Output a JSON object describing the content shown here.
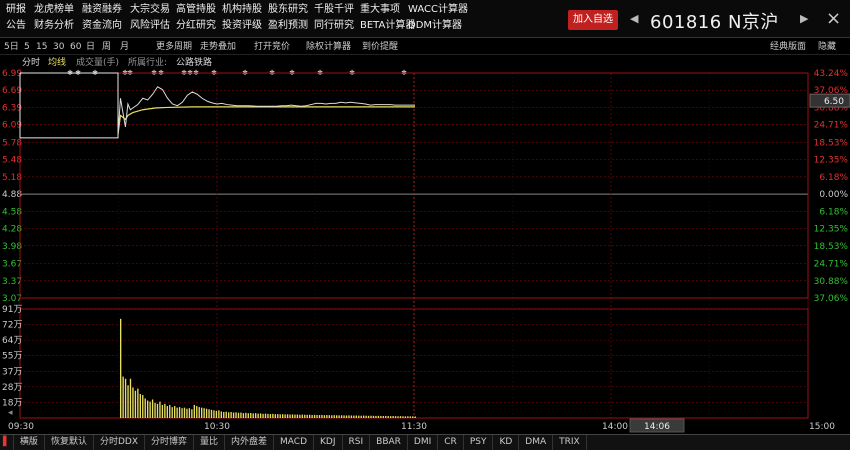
{
  "menu": {
    "row1": [
      "研报",
      "龙虎榜单",
      "融资融券",
      "大宗交易",
      "高管持股",
      "机构持股",
      "股东研究",
      "千股千评",
      "重大事项",
      "WACC计算器"
    ],
    "row2": [
      "公告",
      "财务分析",
      "资金流向",
      "风险评估",
      "分红研究",
      "投资评级",
      "盈利预测",
      "同行研究",
      "BETA计算器",
      "DDM计算器"
    ]
  },
  "header": {
    "add_watch": "加入自选",
    "prev": "◀",
    "next": "▶",
    "stock_code": "601816",
    "stock_name": "N京沪",
    "close": "×"
  },
  "toolbar": {
    "periods": [
      "5日",
      "5",
      "15",
      "30",
      "60",
      "日",
      "周",
      "月"
    ],
    "more_periods": "更多周期",
    "overlay": "走势叠加",
    "open_bidding": "打开竞价",
    "rights_calc": "除权计算器",
    "price_alert": "到价提醒",
    "classic_layout": "经典版面",
    "hide": "隐藏"
  },
  "chart_header": {
    "tab_timeshare": "分时",
    "tab_avg": "均线",
    "volume_label": "成交量(手)",
    "industry_label": "所属行业:",
    "industry_value": "公路铁路"
  },
  "chart_data": {
    "type": "line",
    "title": "",
    "price_labels_left": [
      "6.99",
      "6.69",
      "6.39",
      "6.09",
      "5.78",
      "5.48",
      "5.18",
      "4.88",
      "4.58",
      "4.28",
      "3.98",
      "3.67",
      "3.37",
      "3.07"
    ],
    "pct_labels_right": [
      "43.24%",
      "37.06%",
      "30.88%",
      "24.71%",
      "18.53%",
      "12.35%",
      "6.18%",
      "0.00%",
      "6.18%",
      "12.35%",
      "18.53%",
      "24.71%",
      "30.88%",
      "37.06%"
    ],
    "price_ticks": [
      6.99,
      6.69,
      6.39,
      6.09,
      5.78,
      5.48,
      5.18,
      4.88,
      4.58,
      4.28,
      3.98,
      3.67,
      3.37,
      3.07
    ],
    "ylim": [
      3.07,
      6.99
    ],
    "current_price": "6.50",
    "volume_labels_left": [
      "91万",
      "72万",
      "64万",
      "55万",
      "37万",
      "28万",
      "18万"
    ],
    "x_ticks": [
      "09:30",
      "10:30",
      "11:30",
      "14:00",
      "15:00"
    ],
    "cursor_time": "14:06",
    "auction_box": {
      "high": 6.99,
      "low": 5.86
    },
    "price_series": [
      [
        0,
        5.92
      ],
      [
        1,
        6.55
      ],
      [
        2,
        6.3
      ],
      [
        3,
        6.05
      ],
      [
        4,
        6.45
      ],
      [
        5,
        6.35
      ],
      [
        6,
        6.38
      ],
      [
        8,
        6.44
      ],
      [
        10,
        6.55
      ],
      [
        12,
        6.52
      ],
      [
        14,
        6.62
      ],
      [
        16,
        6.75
      ],
      [
        18,
        6.7
      ],
      [
        20,
        6.55
      ],
      [
        22,
        6.45
      ],
      [
        24,
        6.42
      ],
      [
        26,
        6.48
      ],
      [
        28,
        6.6
      ],
      [
        30,
        6.66
      ],
      [
        32,
        6.62
      ],
      [
        34,
        6.55
      ],
      [
        36,
        6.5
      ],
      [
        38,
        6.47
      ],
      [
        40,
        6.45
      ],
      [
        42,
        6.46
      ],
      [
        44,
        6.44
      ],
      [
        46,
        6.43
      ],
      [
        48,
        6.42
      ],
      [
        50,
        6.42
      ],
      [
        53,
        6.42
      ],
      [
        56,
        6.41
      ],
      [
        58,
        6.41
      ],
      [
        60,
        6.41
      ],
      [
        62,
        6.41
      ],
      [
        64,
        6.41
      ],
      [
        66,
        6.42
      ],
      [
        68,
        6.42
      ],
      [
        70,
        6.43
      ],
      [
        72,
        6.42
      ],
      [
        74,
        6.41
      ],
      [
        76,
        6.42
      ],
      [
        78,
        6.44
      ],
      [
        80,
        6.46
      ],
      [
        82,
        6.46
      ],
      [
        84,
        6.45
      ],
      [
        86,
        6.46
      ],
      [
        88,
        6.46
      ],
      [
        90,
        6.48
      ],
      [
        92,
        6.47
      ],
      [
        94,
        6.48
      ],
      [
        96,
        6.47
      ],
      [
        98,
        6.46
      ],
      [
        100,
        6.45
      ],
      [
        102,
        6.43
      ],
      [
        104,
        6.44
      ],
      [
        106,
        6.44
      ],
      [
        108,
        6.44
      ],
      [
        110,
        6.44
      ],
      [
        112,
        6.43
      ],
      [
        114,
        6.43
      ],
      [
        116,
        6.43
      ],
      [
        118,
        6.43
      ],
      [
        120,
        6.43
      ]
    ],
    "avg_series": [
      [
        0,
        5.92
      ],
      [
        1,
        6.25
      ],
      [
        2,
        6.22
      ],
      [
        3,
        6.18
      ],
      [
        4,
        6.25
      ],
      [
        6,
        6.3
      ],
      [
        10,
        6.35
      ],
      [
        15,
        6.38
      ],
      [
        20,
        6.39
      ],
      [
        30,
        6.4
      ],
      [
        40,
        6.4
      ],
      [
        60,
        6.4
      ],
      [
        80,
        6.4
      ],
      [
        100,
        6.4
      ],
      [
        120,
        6.4
      ]
    ],
    "volume": [
      910000,
      380000,
      360000,
      300000,
      360000,
      280000,
      250000,
      270000,
      220000,
      210000,
      180000,
      160000,
      150000,
      170000,
      140000,
      130000,
      150000,
      120000,
      130000,
      110000,
      120000,
      100000,
      110000,
      95000,
      100000,
      90000,
      95000,
      85000,
      90000,
      80000,
      120000,
      110000,
      100000,
      95000,
      90000,
      85000,
      80000,
      75000,
      70000,
      65000,
      70000,
      60000,
      55000,
      58000,
      52000,
      55000,
      50000,
      52000,
      48000,
      50000,
      45000,
      48000,
      44000,
      46000,
      42000,
      44000,
      40000,
      42000,
      38000,
      40000,
      38000,
      36000,
      38000,
      35000,
      36000,
      34000,
      35000,
      33000,
      34000,
      32000,
      33000,
      31000,
      32000,
      30000,
      31000,
      30000,
      29000,
      30000,
      28000,
      29000,
      28000,
      27000,
      28000,
      26000,
      27000,
      26000,
      25000,
      26000,
      25000,
      24000,
      25000,
      24000,
      23000,
      24000,
      23000,
      22000,
      23000,
      22000,
      21000,
      22000,
      21000,
      20000,
      21000,
      20000,
      19000,
      20000,
      19000,
      18000,
      19000,
      18000,
      17000,
      18000,
      17000,
      16000,
      17000,
      16000,
      15000,
      16000,
      15000,
      15000,
      14000
    ],
    "volume_max": 1000000,
    "total_minutes": 240,
    "colors": {
      "price_line": "#dcdcdc",
      "avg_line": "#e8e060",
      "up_red": "#e03030",
      "down_green": "#30c030",
      "grid_red": "#7a0000",
      "axis_white": "#cccccc",
      "volume_bar": "#e8e060"
    }
  },
  "bottom_tabs": [
    "▌",
    "横版",
    "恢复默认",
    "分时DDX",
    "分时博弈",
    "量比",
    "内外盘差",
    "MACD",
    "KDJ",
    "RSI",
    "BBAR",
    "DMI",
    "CR",
    "PSY",
    "KD",
    "DMA",
    "TRIX"
  ]
}
